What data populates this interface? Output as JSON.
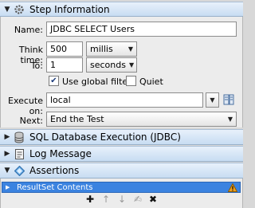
{
  "sections": {
    "step_information": {
      "title": "Step Information",
      "expanded": true
    },
    "sql_execution": {
      "title": "SQL Database Execution (JDBC)",
      "expanded": false
    },
    "log_message": {
      "title": "Log Message",
      "expanded": false
    },
    "assertions": {
      "title": "Assertions",
      "expanded": true
    }
  },
  "form": {
    "name_label": "Name:",
    "name_value": "JDBC SELECT Users",
    "think_time_label": "Think time:",
    "think_time_value": "500",
    "think_time_unit": "millis",
    "to_label": "To:",
    "to_value": "1",
    "to_unit": "seconds",
    "use_global_filters_label": "Use global filters",
    "use_global_filters_checked": true,
    "quiet_label": "Quiet",
    "quiet_checked": false,
    "execute_on_label": "Execute on:",
    "execute_on_value": "local",
    "next_label": "Next:",
    "next_value": "End the Test"
  },
  "assertions": {
    "items": [
      {
        "label": "ResultSet Contents",
        "status": "warning"
      }
    ],
    "toolbar": {
      "add": "✚",
      "move_up": "↑",
      "move_down": "↓",
      "edit": "✍",
      "delete": "✖"
    }
  },
  "colors": {
    "section_bar_top": "#e8f1fb",
    "section_bar_bottom": "#c7dcf2",
    "selected_row": "#3b83e0",
    "warning": "#f0a020"
  }
}
